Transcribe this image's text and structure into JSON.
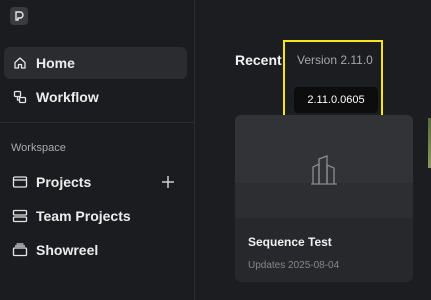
{
  "sidebar": {
    "items": [
      {
        "label": "Home",
        "icon": "home-icon"
      },
      {
        "label": "Workflow",
        "icon": "workflow-icon"
      }
    ],
    "section_label": "Workspace",
    "workspace_items": [
      {
        "label": "Projects",
        "icon": "folder-icon"
      },
      {
        "label": "Team Projects",
        "icon": "server-icon"
      },
      {
        "label": "Showreel",
        "icon": "showreel-icon"
      }
    ]
  },
  "main": {
    "recent_title": "Recent",
    "version_label": "Version 2.11.0",
    "version_tooltip": "2.11.0.0605",
    "cards": [
      {
        "title": "Sequence Test",
        "subtitle": "Updates 2025-08-04"
      }
    ]
  },
  "colors": {
    "background": "#1c1d20",
    "highlight": "#f5e51a",
    "active_nav": "#2b2c30"
  }
}
